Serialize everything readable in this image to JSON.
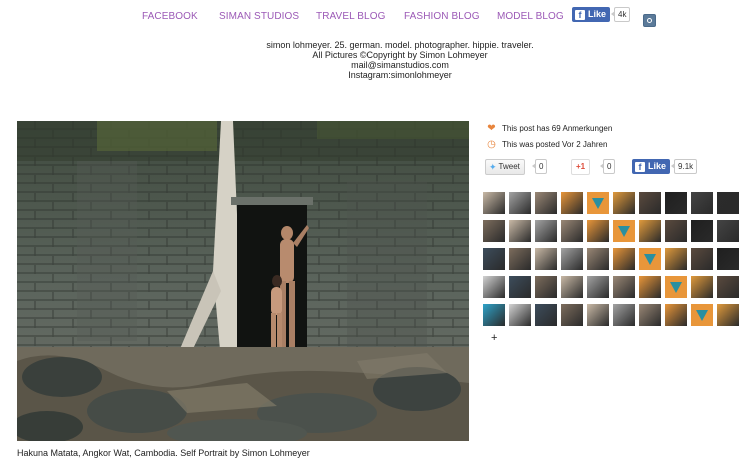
{
  "nav": {
    "items": [
      "FACEBOOK",
      "SIMAN STUDIOS",
      "TRAVEL BLOG",
      "FASHION BLOG",
      "MODEL BLOG"
    ],
    "like_label": "Like",
    "like_count": "4k",
    "instagram_icon": "instagram-icon"
  },
  "bio": {
    "line1": "simon lohmeyer. 25. german. model. photographer. hippie. traveler.",
    "line2": "All Pictures ©Copyright by Simon Lohmeyer",
    "line3": "mail@simanstudios.com",
    "line4": "Instagram:simonlohmeyer"
  },
  "post": {
    "caption": "Hakuna Matata, Angkor Wat, Cambodia. Self Portrait by Simon Lohmeyer",
    "notes": "This post has 69 Anmerkungen",
    "posted": "This was posted Vor 2 Jahren"
  },
  "share": {
    "tweet_label": "Tweet",
    "tweet_count": "0",
    "gplus_label": "+1",
    "gplus_count": "0",
    "fb_label": "Like",
    "fb_count": "9.1k"
  },
  "likers": {
    "more_label": "+",
    "count": 50
  },
  "colors": {
    "nav_link": "#9b59b6",
    "facebook": "#4267b2",
    "meta_icon": "#e8853d",
    "twitter": "#55acee",
    "gplus": "#dd4b39"
  }
}
